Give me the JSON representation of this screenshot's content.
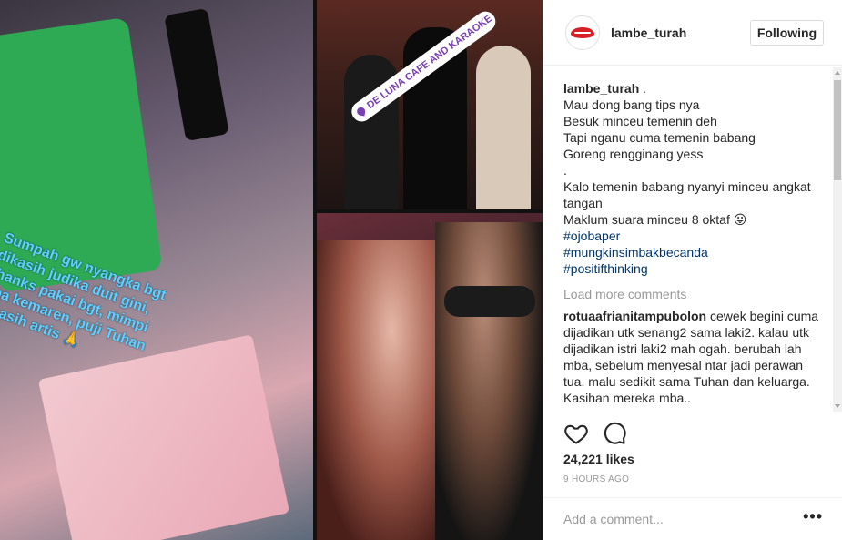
{
  "post": {
    "username": "lambe_turah",
    "follow_label": "Following",
    "location_tag": "DE LUNA CAFE AND KARAOKE",
    "story_text": "Sumpah gw nyangka bgt dikasih judika duit gini, thanks pakai bgt, mimpi apa kemaren, puji Tuhan dikasih artis 🙏"
  },
  "caption": {
    "username": "lambe_turah",
    "suffix": " .",
    "lines": [
      "Mau dong bang tips nya",
      "Besuk minceu temenin deh",
      "Tapi nganu cuma temenin babang",
      "Goreng rengginang yess",
      ".",
      "Kalo temenin babang nyanyi minceu angkat tangan",
      "Maklum suara minceu 8 oktaf 😛"
    ],
    "hashtags": [
      "#ojobaper",
      "#mungkinsimbakbecanda",
      "#positifthinking"
    ]
  },
  "load_more": "Load more comments",
  "comments": [
    {
      "username": "rotuaafrianitampubolon",
      "text": " cewek begini cuma dijadikan utk senang2 sama laki2. kalau utk dijadikan istri laki2 mah ogah. berubah lah mba, sebelum menyesal ntar jadi perawan tua. malu sedikit sama Tuhan dan keluarga. Kasihan mereka mba.."
    }
  ],
  "likes": "24,221 likes",
  "time": "9 HOURS AGO",
  "add_comment_placeholder": "Add a comment...",
  "more_label": "•••",
  "icons": {
    "like": "heart-icon",
    "comment": "comment-icon",
    "avatar": "lips-logo"
  },
  "colors": {
    "hashtag": "#003569",
    "muted": "#999999",
    "text": "#262626",
    "logo_red": "#d81f26"
  }
}
